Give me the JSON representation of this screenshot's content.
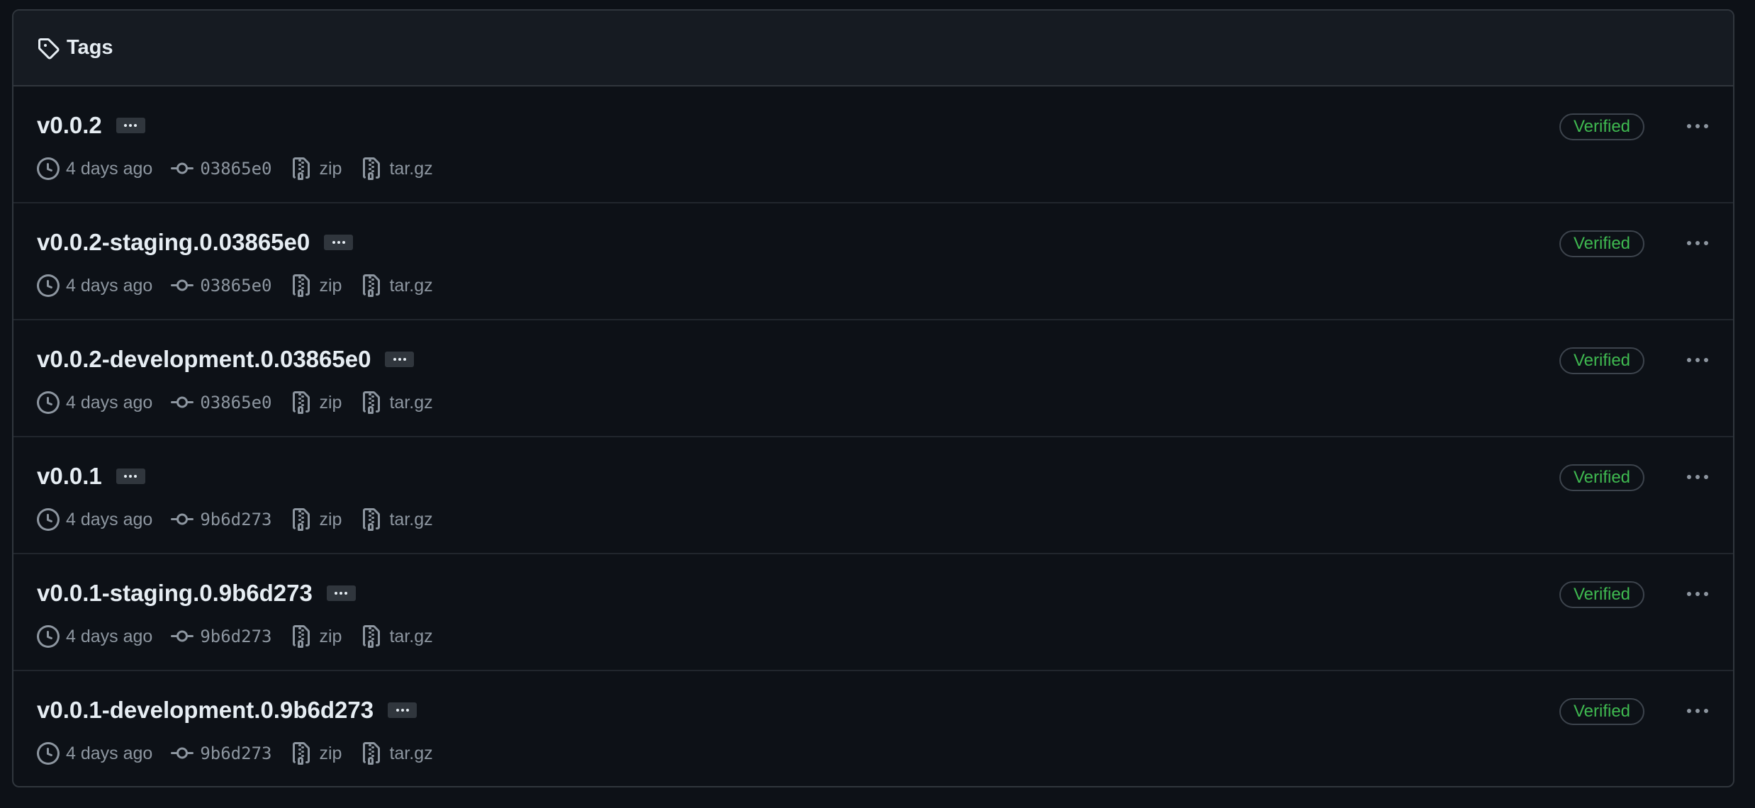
{
  "header": {
    "title": "Tags",
    "icon": "tag-icon"
  },
  "colors": {
    "background": "#0d1117",
    "header_bg": "#161b22",
    "border": "#30363d",
    "text": "#e6edf3",
    "muted": "#8d96a0",
    "verified": "#3fb950"
  },
  "tags": [
    {
      "name": "v0.0.2",
      "time": "4 days ago",
      "commit": "03865e0",
      "zip": "zip",
      "targz": "tar.gz",
      "badge": "Verified"
    },
    {
      "name": "v0.0.2-staging.0.03865e0",
      "time": "4 days ago",
      "commit": "03865e0",
      "zip": "zip",
      "targz": "tar.gz",
      "badge": "Verified"
    },
    {
      "name": "v0.0.2-development.0.03865e0",
      "time": "4 days ago",
      "commit": "03865e0",
      "zip": "zip",
      "targz": "tar.gz",
      "badge": "Verified"
    },
    {
      "name": "v0.0.1",
      "time": "4 days ago",
      "commit": "9b6d273",
      "zip": "zip",
      "targz": "tar.gz",
      "badge": "Verified"
    },
    {
      "name": "v0.0.1-staging.0.9b6d273",
      "time": "4 days ago",
      "commit": "9b6d273",
      "zip": "zip",
      "targz": "tar.gz",
      "badge": "Verified"
    },
    {
      "name": "v0.0.1-development.0.9b6d273",
      "time": "4 days ago",
      "commit": "9b6d273",
      "zip": "zip",
      "targz": "tar.gz",
      "badge": "Verified"
    }
  ],
  "icons": {
    "time": "clock-icon",
    "commit": "git-commit-icon",
    "archive": "file-zip-icon",
    "more": "kebab-horizontal-icon"
  }
}
